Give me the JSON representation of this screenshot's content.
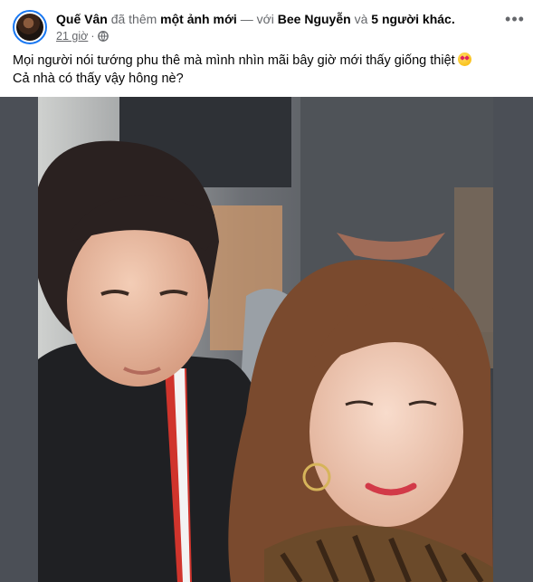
{
  "post": {
    "author": "Quế Vân",
    "action_text": "đã thêm",
    "action_object": "một ảnh mới",
    "with_text": "— với",
    "tagged_person": "Bee Nguyễn",
    "and_text": "và",
    "others_link": "5 người khác.",
    "timestamp": "21 giờ",
    "separator": "·",
    "privacy_icon": "globe-icon",
    "more_icon": "more-options-icon",
    "caption_line1": "Mọi người nói tướng phu thê mà mình nhìn mãi bây giờ mới thấy giống thiệt",
    "caption_emoji": "heart-eyes-emoji",
    "caption_line2": "Cả nhà có thấy vậy hông nè?"
  },
  "photo": {
    "description_icon": "post-photo"
  },
  "colors": {
    "text_primary": "#050505",
    "text_secondary": "#65676b",
    "accent": "#1877f2",
    "photo_border": "#4b4f56"
  }
}
